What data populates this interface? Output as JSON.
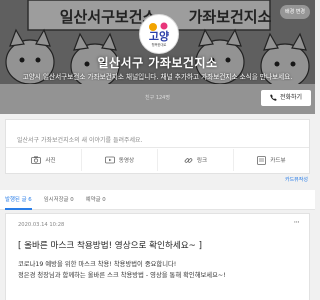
{
  "header": {
    "edit_label": "배경 변경",
    "banner_text": "일산서구보건소",
    "banner_text2": "가좌보건지소",
    "title": "일산서구 가좌보건지소",
    "description": "고양시 일산서구보건소 가좌보건지소 채널입니다. 채널 추가하고 가좌보건지소 소식을 만나보세요.",
    "subtitle": "친구 124명",
    "call_label": "전화하기",
    "logo_text": "고양",
    "logo_small": "행복한대로"
  },
  "composer": {
    "placeholder": "일산서구 가좌보건지소의 새 이야기를 들려주세요.",
    "actions": [
      {
        "label": "사진",
        "icon": "camera-icon"
      },
      {
        "label": "동영상",
        "icon": "video-icon"
      },
      {
        "label": "링크",
        "icon": "link-icon"
      },
      {
        "label": "카드뷰",
        "icon": "cardview-icon"
      }
    ],
    "card_button": "카드뷰작성"
  },
  "tabs": [
    {
      "label": "발행된 글 6",
      "active": true
    },
    {
      "label": "임시저장글 0",
      "active": false
    },
    {
      "label": "예약글 0",
      "active": false
    }
  ],
  "post": {
    "date": "2020.03.14 10:28",
    "more": "···",
    "heading": "[ 올바른 마스크 착용방법! 영상으로 확인하세요~ ]",
    "line1": "코로나19 예방을 위한 마스크 착용! 착용방법이 중요합니다!",
    "line2": "정은경 청장님과 함께하는 올바른 스크 착용방법 - 영상을 통해 확인해보세요~!"
  },
  "colors": {
    "accent": "#2a7ee8",
    "cover_bg": "#6b6b6b"
  }
}
